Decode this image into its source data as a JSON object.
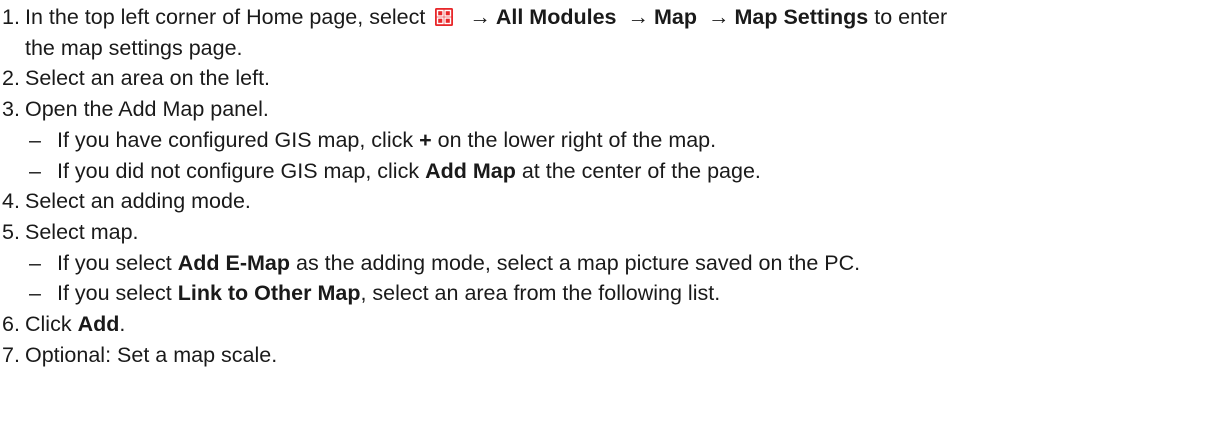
{
  "steps": [
    {
      "num": "1.",
      "t1": "In the top left corner of Home page, select",
      "arrow": "→",
      "b1": "All Modules",
      "b2": "Map",
      "b3": "Map Settings",
      "t2": "to enter",
      "t3": "the map settings page."
    },
    {
      "num": "2.",
      "text": "Select an area on the left."
    },
    {
      "num": "3.",
      "text": "Open the Add Map panel."
    },
    {
      "num": "4.",
      "text": "Select an adding mode."
    },
    {
      "num": "5.",
      "text": "Select map."
    },
    {
      "num": "6.",
      "t1": "Click",
      "b1": "Add",
      "t2": "."
    },
    {
      "num": "7.",
      "text": "Optional: Set a map scale."
    }
  ],
  "subs3": [
    {
      "dash": "–",
      "t1": "If you have configured GIS map, click",
      "b1": "+",
      "t2": "on the lower right of the map."
    },
    {
      "dash": "–",
      "t1": "If you did not configure GIS map, click",
      "b1": "Add Map",
      "t2": "at the center of the page."
    }
  ],
  "subs5": [
    {
      "dash": "–",
      "t1": "If you select",
      "b1": "Add E-Map",
      "t2": "as the adding mode, select a map picture saved on the PC."
    },
    {
      "dash": "–",
      "t1": "If you select",
      "b1": "Link to Other Map",
      "t2": ", select an area from the following list."
    }
  ],
  "icons": {
    "menu": "modules-grid-icon",
    "menu_color": "#e8272a"
  }
}
